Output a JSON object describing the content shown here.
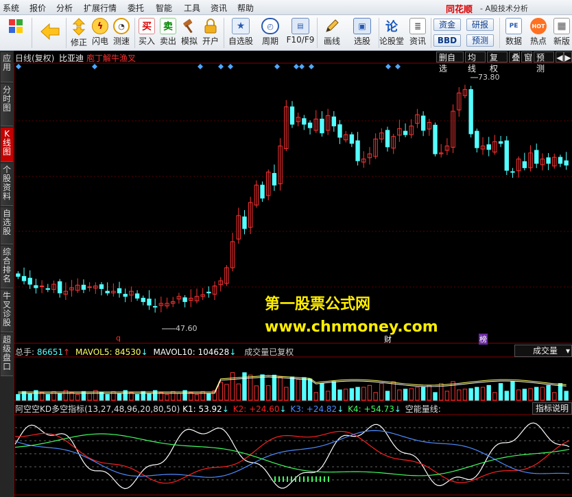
{
  "menu": {
    "items": [
      "系统",
      "报价",
      "分析",
      "扩展行情",
      "委托",
      "智能",
      "工具",
      "资讯",
      "帮助"
    ],
    "brand": "同花顺",
    "app_title": "- A股技术分析"
  },
  "toolbar": {
    "back_label": "",
    "fix_label": "修正",
    "speed_label": "闪电",
    "test_label": "测速",
    "buy_icon": "买",
    "buy_label": "买入",
    "sell_icon": "卖",
    "sell_label": "卖出",
    "simulate_label": "模拟",
    "open_label": "开户",
    "watchlist_label": "自选股",
    "period_label": "周期",
    "f10_label": "F10/F9",
    "draw_label": "画线",
    "select_label": "选股",
    "forum_icon": "论",
    "forum_label": "论股堂",
    "news_label": "资讯",
    "fund_label": "资金",
    "research_label": "研报",
    "bbd_label": "BBD",
    "forecast_label": "预测",
    "data_icon": "PE",
    "data_label": "数据",
    "hot_icon": "HOT",
    "hot_label": "热点",
    "newversion_label": "新版"
  },
  "left_tabs": [
    {
      "label": "应用"
    },
    {
      "label": "分时图"
    },
    {
      "label": "K线图"
    },
    {
      "label": "个股资料"
    },
    {
      "label": "自选股"
    },
    {
      "label": "综合排名"
    },
    {
      "label": "牛叉诊股"
    },
    {
      "label": "超级盘口"
    }
  ],
  "chart_header": {
    "mode": "日线(复权)",
    "stock": "比亚迪",
    "formula": "庖丁解牛渔叉"
  },
  "right_buttons": [
    "删自选",
    "均线",
    "复权",
    "叠",
    "窗",
    "预测"
  ],
  "nav_arrows": {
    "left": "◀",
    "right": "▶"
  },
  "annotations": {
    "high_label": "73.80",
    "low_label": "47.60",
    "marker_q": "q",
    "marker_cai": "财",
    "marker_bang": "榜"
  },
  "watermark": {
    "line1": "第一股票公式网",
    "line2": "www.chnmoney.com"
  },
  "volume_header": {
    "total_label": "总手: ",
    "total_value": "86651",
    "total_arrow": "↑",
    "mavol5_label": "MAVOL5: ",
    "mavol5_value": "84530",
    "mavol5_arrow": "↓",
    "mavol10_label": "MAVOL10: ",
    "mavol10_value": "104628",
    "mavol10_arrow": "↓",
    "note": "成交量已复权",
    "dropdown": "成交量"
  },
  "indicator_header": {
    "name": "阿空空KD多空指标(13,27,48,96,20,80,50)",
    "k1_label": "K1: ",
    "k1_value": "53.92",
    "k1_arrow": "↓",
    "k2_label": "K2: ",
    "k2_value": "+24.60",
    "k2_arrow": "↓",
    "k3_label": "K3: ",
    "k3_value": "+24.82",
    "k3_arrow": "↓",
    "k4_label": "K4: ",
    "k4_value": "+54.73",
    "k4_arrow": "↓",
    "kong_label": "空能量线:",
    "button": "指标说明"
  },
  "colors": {
    "up": "#ff3333",
    "down": "#54ffff",
    "accent_red": "#c40000",
    "watermark": "#ffee00",
    "k1": "#ffffff",
    "k2": "#ff2020",
    "k3": "#4c8cff",
    "k4": "#40ff60"
  },
  "chart_data": {
    "type": "candlestick",
    "close_series": [
      51.5,
      51.0,
      50.6,
      50.2,
      50.4,
      50.0,
      50.6,
      49.6,
      49.8,
      50.2,
      50.5,
      50.0,
      50.3,
      50.4,
      50.1,
      49.6,
      49.8,
      49.6,
      49.2,
      49.8,
      49.0,
      48.6,
      48.2,
      48.0,
      48.4,
      48.4,
      48.6,
      49.2,
      48.6,
      49.0,
      49.2,
      49.4,
      49.6,
      50.4,
      51.0,
      52.5,
      55.5,
      58.5,
      57.0,
      60.0,
      62.0,
      60.5,
      63.5,
      62.0,
      66.5,
      71.0,
      69.0,
      69.8,
      69.0,
      68.6,
      69.6,
      68.0,
      70.0,
      68.8,
      67.5,
      67.8,
      66.8,
      64.8,
      65.0,
      65.6,
      67.3,
      68.0,
      66.4,
      67.6,
      68.5,
      67.8,
      68.8,
      70.1,
      68.3,
      69.2,
      65.6,
      65.7,
      66.5,
      70.5,
      72.6,
      73.0,
      67.9,
      66.3,
      66.5,
      66.1,
      67.0,
      66.8,
      63.7,
      63.5,
      65.0,
      64.0,
      65.7,
      64.5,
      65.0,
      64.5,
      65.2,
      64.5,
      64.3
    ],
    "high": 73.8,
    "low": 47.6
  }
}
